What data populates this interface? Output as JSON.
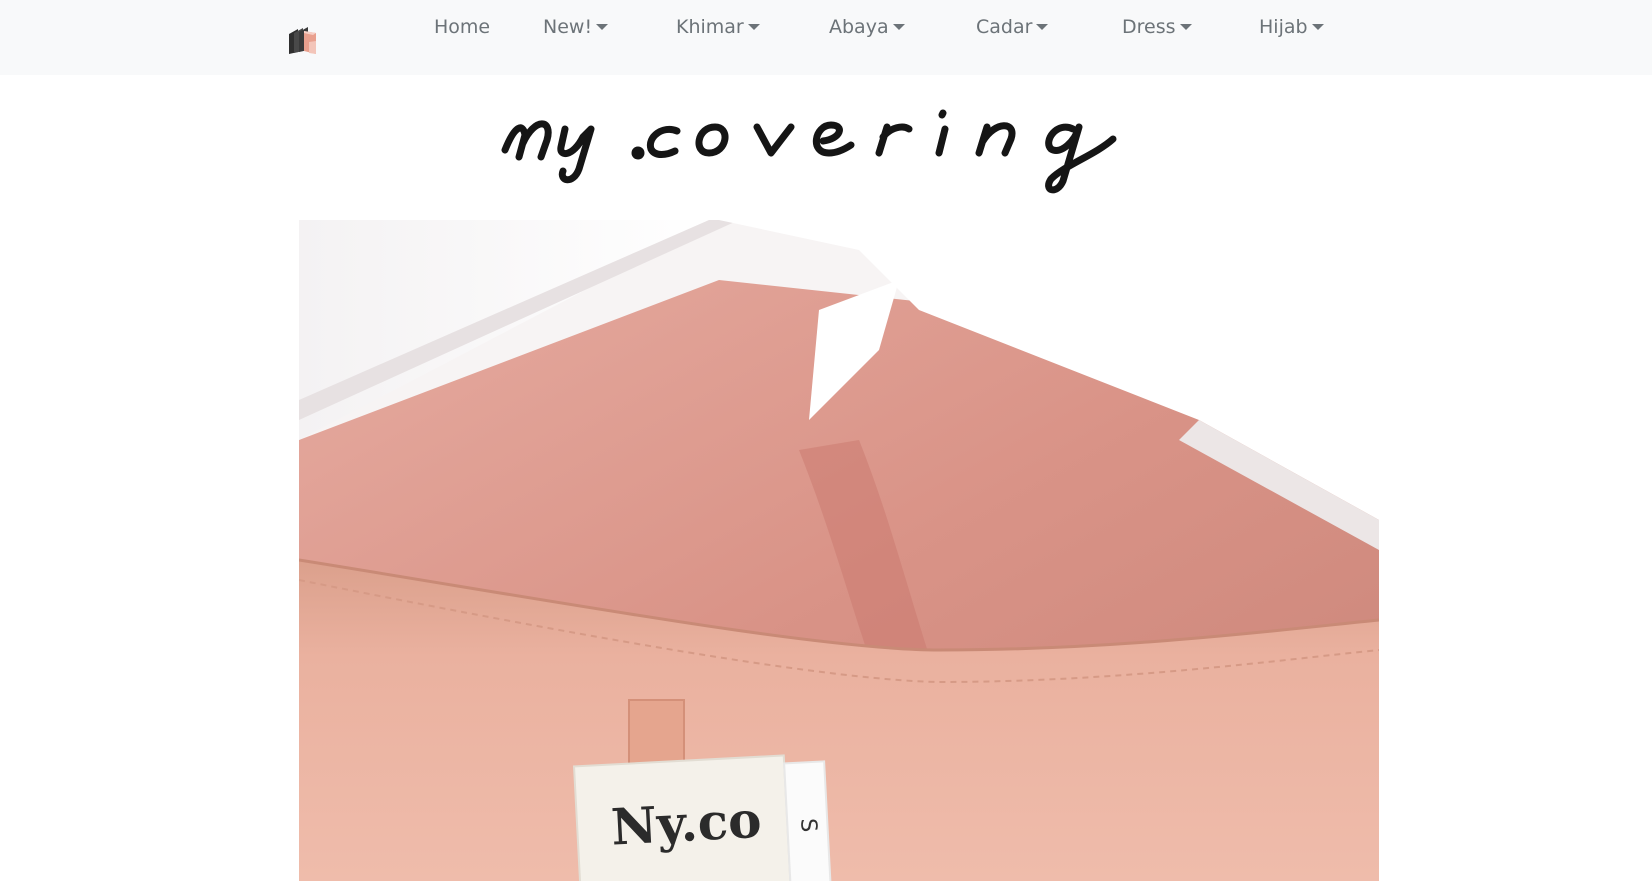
{
  "brand": {
    "icon": "stacked-books-icon",
    "logo_script_text": "ny.covering"
  },
  "nav": {
    "items": [
      {
        "label": "Home",
        "dropdown": false
      },
      {
        "label": "New!",
        "dropdown": true
      },
      {
        "label": "Khimar",
        "dropdown": true
      },
      {
        "label": "Abaya",
        "dropdown": true
      },
      {
        "label": "Cadar",
        "dropdown": true
      },
      {
        "label": "Dress",
        "dropdown": true
      },
      {
        "label": "Hijab",
        "dropdown": true
      }
    ]
  },
  "hero": {
    "garment_label_text": "Ny.co",
    "size_tag_text": "S"
  },
  "colors": {
    "navbar_bg": "#f8f9fa",
    "nav_text": "#6c7378",
    "garment_pink": "#e2a08f"
  }
}
